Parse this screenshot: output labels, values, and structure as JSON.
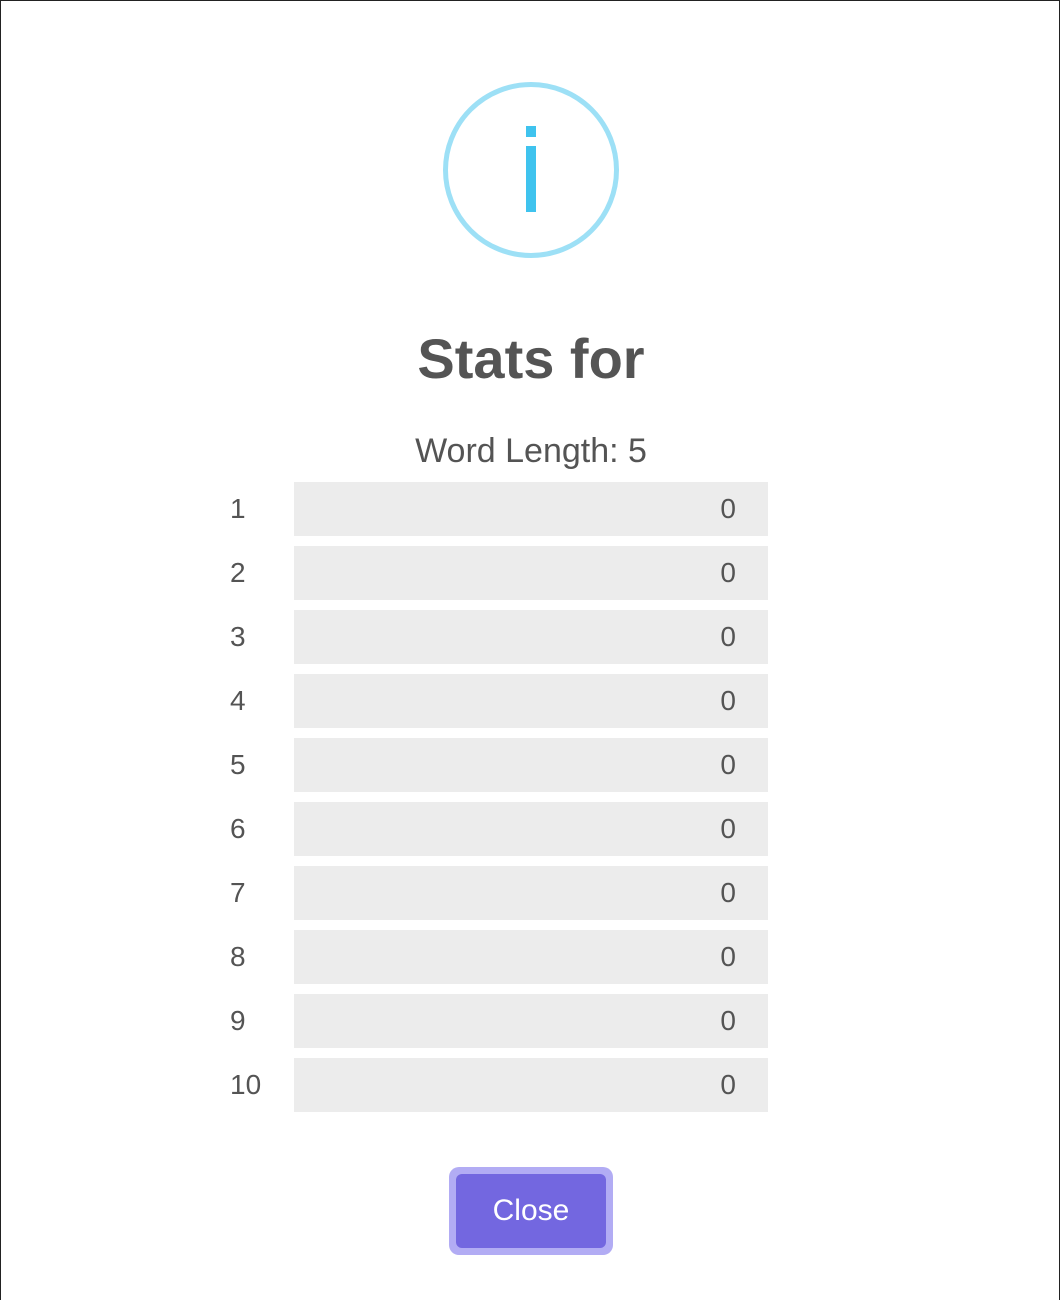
{
  "dialog": {
    "icon": "info-icon",
    "title": "Stats for",
    "subtitle": "Word Length: 5",
    "close_label": "Close"
  },
  "colors": {
    "icon_ring": "#9de0f6",
    "icon_glyph": "#3fc3ee",
    "bar_track": "#ececec",
    "button": "#7367e0",
    "button_focus_ring": "#b2acf4",
    "text": "#545454"
  },
  "stats": {
    "rows": [
      {
        "label": "1",
        "value": "0",
        "fraction": 0
      },
      {
        "label": "2",
        "value": "0",
        "fraction": 0
      },
      {
        "label": "3",
        "value": "0",
        "fraction": 0
      },
      {
        "label": "4",
        "value": "0",
        "fraction": 0
      },
      {
        "label": "5",
        "value": "0",
        "fraction": 0
      },
      {
        "label": "6",
        "value": "0",
        "fraction": 0
      },
      {
        "label": "7",
        "value": "0",
        "fraction": 0
      },
      {
        "label": "8",
        "value": "0",
        "fraction": 0
      },
      {
        "label": "9",
        "value": "0",
        "fraction": 0
      },
      {
        "label": "10",
        "value": "0",
        "fraction": 0
      }
    ]
  }
}
